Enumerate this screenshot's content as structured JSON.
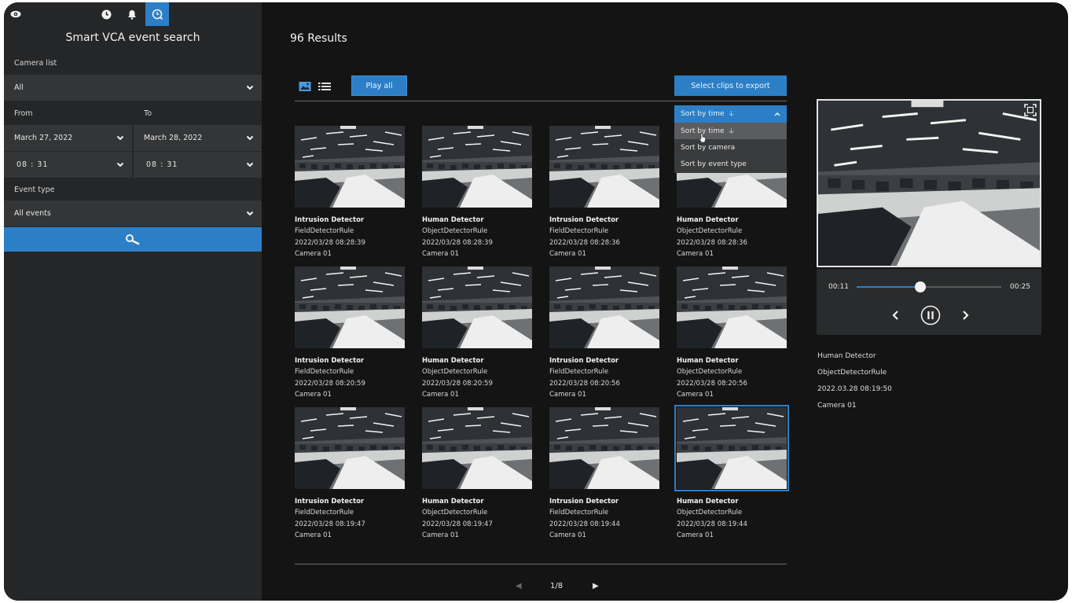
{
  "sidebar": {
    "title": "Smart VCA event search",
    "camera_list_label": "Camera list",
    "camera_list_value": "All",
    "from_label": "From",
    "to_label": "To",
    "from_date": "March 27, 2022",
    "to_date": "March 28, 2022",
    "from_time": "08 : 31",
    "to_time": "08 : 31",
    "event_type_label": "Event type",
    "event_type_value": "All events",
    "top_icons": [
      "eye-icon",
      "clock-icon",
      "bell-icon",
      "smart-search-icon"
    ]
  },
  "main": {
    "results_title": "96 Results",
    "play_all": "Play all",
    "select_export": "Select clips to export",
    "sort": {
      "selected": "Sort by time",
      "options": [
        "Sort by time",
        "Sort by camera",
        "Sort by event type"
      ]
    },
    "events": [
      {
        "title": "Intrusion Detector",
        "rule": "FieldDetectorRule",
        "time": "2022/03/28 08:28:39",
        "camera": "Camera 01"
      },
      {
        "title": "Human Detector",
        "rule": "ObjectDetectorRule",
        "time": "2022/03/28 08:28:39",
        "camera": "Camera 01"
      },
      {
        "title": "Intrusion Detector",
        "rule": "FieldDetectorRule",
        "time": "2022/03/28 08:28:36",
        "camera": "Camera 01"
      },
      {
        "title": "Human Detector",
        "rule": "ObjectDetectorRule",
        "time": "2022/03/28 08:28:36",
        "camera": "Camera 01"
      },
      {
        "title": "Intrusion Detector",
        "rule": "FieldDetectorRule",
        "time": "2022/03/28 08:20:59",
        "camera": "Camera 01"
      },
      {
        "title": "Human Detector",
        "rule": "ObjectDetectorRule",
        "time": "2022/03/28 08:20:59",
        "camera": "Camera 01"
      },
      {
        "title": "Intrusion Detector",
        "rule": "FieldDetectorRule",
        "time": "2022/03/28 08:20:56",
        "camera": "Camera 01"
      },
      {
        "title": "Human Detector",
        "rule": "ObjectDetectorRule",
        "time": "2022/03/28 08:20:56",
        "camera": "Camera 01"
      },
      {
        "title": "Intrusion Detector",
        "rule": "FieldDetectorRule",
        "time": "2022/03/28 08:19:47",
        "camera": "Camera 01"
      },
      {
        "title": "Human Detector",
        "rule": "ObjectDetectorRule",
        "time": "2022/03/28 08:19:47",
        "camera": "Camera 01"
      },
      {
        "title": "Intrusion Detector",
        "rule": "FieldDetectorRule",
        "time": "2022/03/28 08:19:44",
        "camera": "Camera 01"
      },
      {
        "title": "Human Detector",
        "rule": "ObjectDetectorRule",
        "time": "2022/03/28 08:19:44",
        "camera": "Camera 01",
        "selected": true
      }
    ],
    "pagination": "1/8"
  },
  "preview": {
    "current_time": "00:11",
    "total_time": "00:25",
    "progress": 0.44,
    "event_title": "Human Detector",
    "event_rule": "ObjectDetectorRule",
    "event_time": "2022.03.28 08:19:50",
    "event_camera": "Camera 01"
  },
  "colors": {
    "accent": "#2c7fc6",
    "sidebar_bg": "#252627",
    "main_bg": "#141414"
  }
}
